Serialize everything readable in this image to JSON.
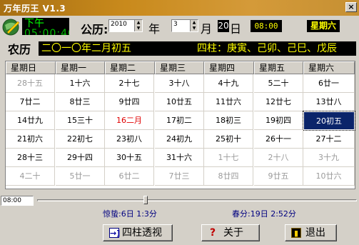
{
  "window": {
    "title": "万年历王 V1.3",
    "close_glyph": "×"
  },
  "clock": {
    "ampm": "下午",
    "time": "05:00:40"
  },
  "solar": {
    "label": "公历:",
    "year": "2010",
    "nian": "年",
    "month": "3",
    "yue": "月",
    "day": "20",
    "ri": "日",
    "time": "08:00",
    "weekday": "星期六"
  },
  "lunar": {
    "label": "农历",
    "date": "二〇一〇年二月初五",
    "sizhu": "四柱：庚寅、己卯、己巳、戊辰"
  },
  "calendar": {
    "headers": [
      "星期日",
      "星期一",
      "星期二",
      "星期三",
      "星期四",
      "星期五",
      "星期六"
    ],
    "rows": [
      [
        "28十五",
        "1十六",
        "2十七",
        "3十八",
        "4十九",
        "5二十",
        "6廿一"
      ],
      [
        "7廿二",
        "8廿三",
        "9廿四",
        "10廿五",
        "11廿六",
        "12廿七",
        "13廿八"
      ],
      [
        "14廿九",
        "15三十",
        "16二月",
        "17初二",
        "18初三",
        "19初四",
        "20初五"
      ],
      [
        "21初六",
        "22初七",
        "23初八",
        "24初九",
        "25初十",
        "26十一",
        "27十二"
      ],
      [
        "28十三",
        "29十四",
        "30十五",
        "31十六",
        "1十七",
        "2十八",
        "3十九"
      ],
      [
        "4二十",
        "5廿一",
        "6廿二",
        "7廿三",
        "8廿四",
        "9廿五",
        "10廿六"
      ]
    ],
    "selected": "20初五"
  },
  "slider": {
    "time": "08:00"
  },
  "solar_terms": {
    "term1": "惊蛰:6日 1:3分",
    "term2": "春分:19日 2:52分"
  },
  "buttons": {
    "sizhu": "四柱透视",
    "about": "关于",
    "exit": "退出",
    "sizhu_icon": "→]",
    "about_icon": "?",
    "exit_icon": "▮"
  },
  "colors": {
    "selected_bg": "#0a246a",
    "lunar_text": "#ffff00",
    "holiday": "#e00000",
    "term_text": "#000080"
  }
}
